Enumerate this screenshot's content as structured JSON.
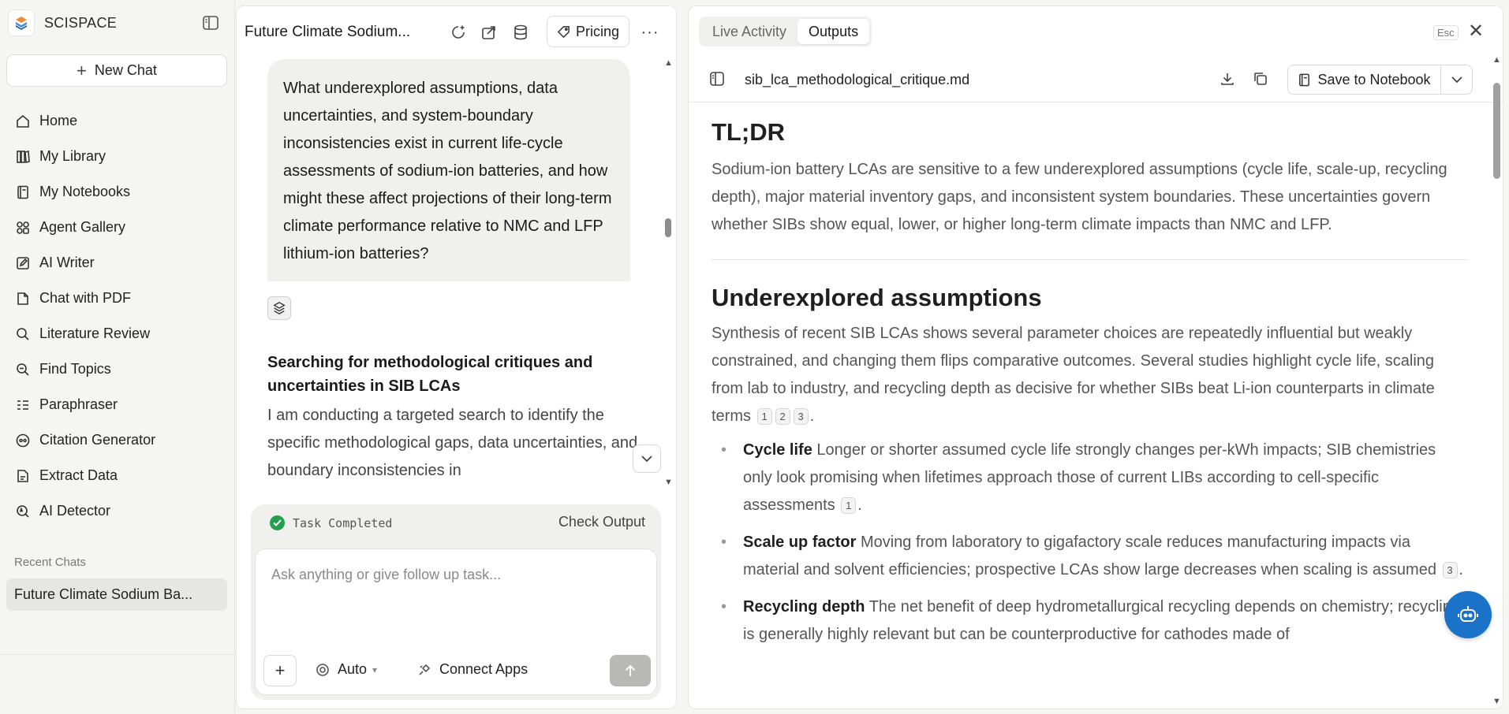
{
  "colors": {
    "accent": "#1a73c8",
    "success": "#22a04b",
    "send_disabled": "#b8b8b6"
  },
  "sidebar": {
    "brand_name": "SCISPACE",
    "new_chat_label": "New Chat",
    "items": [
      {
        "label": "Home",
        "icon": "home-icon"
      },
      {
        "label": "My Library",
        "icon": "library-icon"
      },
      {
        "label": "My Notebooks",
        "icon": "notebook-icon"
      },
      {
        "label": "Agent Gallery",
        "icon": "agents-icon"
      },
      {
        "label": "AI Writer",
        "icon": "pen-icon"
      },
      {
        "label": "Chat with PDF",
        "icon": "pdf-icon"
      },
      {
        "label": "Literature Review",
        "icon": "search-icon"
      },
      {
        "label": "Find Topics",
        "icon": "topics-icon"
      },
      {
        "label": "Paraphraser",
        "icon": "paraphrase-icon"
      },
      {
        "label": "Citation Generator",
        "icon": "quote-icon"
      },
      {
        "label": "Extract Data",
        "icon": "extract-icon"
      },
      {
        "label": "AI Detector",
        "icon": "detector-icon"
      }
    ],
    "recent_label": "Recent Chats",
    "recent_chats": [
      "Future Climate Sodium Ba..."
    ]
  },
  "chat": {
    "title": "Future Climate Sodium...",
    "pricing_label": "Pricing",
    "more_label": "···",
    "user_message": "What underexplored assumptions, data uncertainties, and system-boundary inconsistencies exist in current life-cycle assessments of sodium-ion batteries, and how might these affect projections of their long-term climate performance relative to NMC and LFP lithium-ion batteries?",
    "step_title": "Searching for methodological critiques and uncertainties in SIB LCAs",
    "step_body": "I am conducting a targeted search to identify the specific methodological gaps, data uncertainties, and boundary inconsistencies in",
    "task_status": "Task Completed",
    "check_output_label": "Check Output",
    "composer": {
      "placeholder": "Ask anything or give follow up task...",
      "mode_label": "Auto",
      "connect_apps_label": "Connect Apps"
    }
  },
  "outputs": {
    "tabs": [
      {
        "label": "Live Activity",
        "active": false
      },
      {
        "label": "Outputs",
        "active": true
      }
    ],
    "esc_label": "Esc",
    "file_name": "sib_lca_methodological_critique.md",
    "save_label": "Save to Notebook",
    "doc": {
      "tldr_heading": "TL;DR",
      "tldr_text": "Sodium-ion battery LCAs are sensitive to a few underexplored assumptions (cycle life, scale-up, recycling depth), major material inventory gaps, and inconsistent system boundaries. These uncertainties govern whether SIBs show equal, lower, or higher long-term climate impacts than NMC and LFP.",
      "section_heading": "Underexplored assumptions",
      "section_text": "Synthesis of recent SIB LCAs shows several parameter choices are repeatedly influential but weakly constrained, and changing them flips comparative outcomes. Several studies highlight cycle life, scaling from lab to industry, and recycling depth as decisive for whether SIBs beat Li-ion counterparts in climate terms",
      "section_cites": [
        "1",
        "2",
        "3"
      ],
      "bullets": [
        {
          "term": "Cycle life",
          "text": "Longer or shorter assumed cycle life strongly changes per-kWh impacts; SIB chemistries only look promising when lifetimes approach those of current LIBs according to cell-specific assessments",
          "cite": "1"
        },
        {
          "term": "Scale up factor",
          "text": "Moving from laboratory to gigafactory scale reduces manufacturing impacts via material and solvent efficiencies; prospective LCAs show large decreases when scaling is assumed",
          "cite": "3"
        },
        {
          "term": "Recycling depth",
          "text": "The net benefit of deep hydrometallurgical recycling depends on chemistry; recycling is generally highly relevant but can be counterproductive for cathodes made of",
          "cite": ""
        }
      ]
    }
  }
}
